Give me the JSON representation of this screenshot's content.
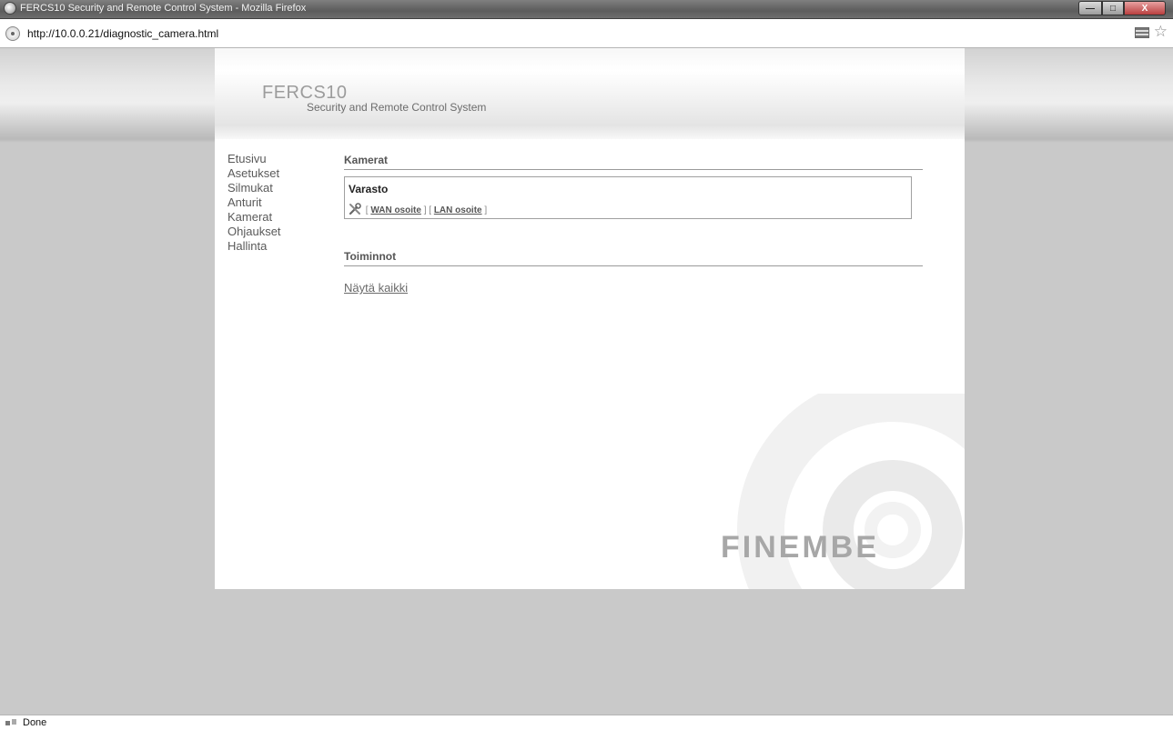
{
  "window": {
    "title": "FERCS10 Security and Remote Control System - Mozilla Firefox",
    "minimize_label": "—",
    "maximize_label": "□",
    "close_label": "X"
  },
  "browser": {
    "url": "http://10.0.0.21/diagnostic_camera.html",
    "status": "Done"
  },
  "header": {
    "product": "FERCS10",
    "subtitle": "Security and Remote Control System"
  },
  "nav": {
    "items": [
      {
        "label": "Etusivu"
      },
      {
        "label": "Asetukset"
      },
      {
        "label": "Silmukat"
      },
      {
        "label": "Anturit"
      },
      {
        "label": "Kamerat"
      },
      {
        "label": "Ohjaukset"
      },
      {
        "label": "Hallinta"
      }
    ]
  },
  "cameras": {
    "heading": "Kamerat",
    "items": [
      {
        "name": "Varasto",
        "icon": "tools-icon",
        "bracket_open": "[",
        "bracket_mid": "] [",
        "bracket_close": "]",
        "wan_label": "WAN osoite",
        "lan_label": "LAN osoite"
      }
    ]
  },
  "functions": {
    "heading": "Toiminnot",
    "show_all": "Näytä kaikki"
  },
  "brand": {
    "logo_text": "FINEMBE"
  },
  "colors": {
    "background": "#c9c9c9",
    "page": "#ffffff",
    "text": "#5a5a5a",
    "logo": "#9c9c9c"
  }
}
